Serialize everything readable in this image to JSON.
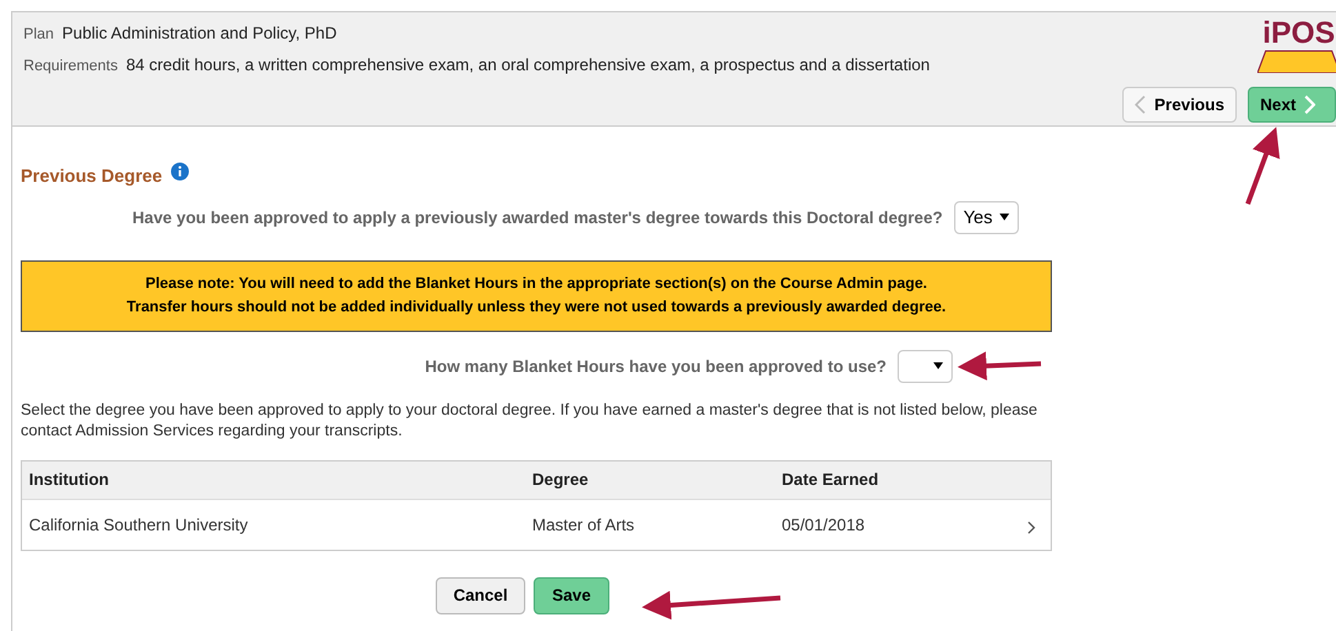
{
  "header": {
    "plan_label": "Plan",
    "plan_value": "Public Administration and Policy, PhD",
    "requirements_label": "Requirements",
    "requirements_value": "84 credit hours, a written comprehensive exam, an oral comprehensive exam, a prospectus and a dissertation",
    "logo_text": "iPOS",
    "buttons": [
      {
        "label": "Previous",
        "kind": "prev"
      },
      {
        "label": "Next",
        "kind": "next"
      }
    ]
  },
  "section_title": "Previous Degree",
  "question_1": {
    "label": "Have you been approved to apply a previously awarded master's degree towards this Doctoral degree?",
    "value": "Yes"
  },
  "notice": [
    "Please note: You will need to add the Blanket Hours in the appropriate section(s) on the Course Admin page.",
    "Transfer hours should not be added individually unless they were not used towards a previously awarded degree."
  ],
  "question_2": {
    "label": "How many Blanket Hours have you been approved to use?"
  },
  "instructions": "Select the degree you have been approved to apply to your doctoral degree. If you have earned a master's degree that is not listed below, please contact Admission Services regarding your transcripts.",
  "table": {
    "columns": [
      "Institution",
      "Degree",
      "Date Earned"
    ],
    "rows": [
      [
        "California Southern University",
        "Master of Arts",
        "05/01/2018"
      ]
    ]
  },
  "actions": [
    {
      "label": "Cancel",
      "kind": "secondary"
    },
    {
      "label": "Save",
      "kind": "primary"
    }
  ]
}
